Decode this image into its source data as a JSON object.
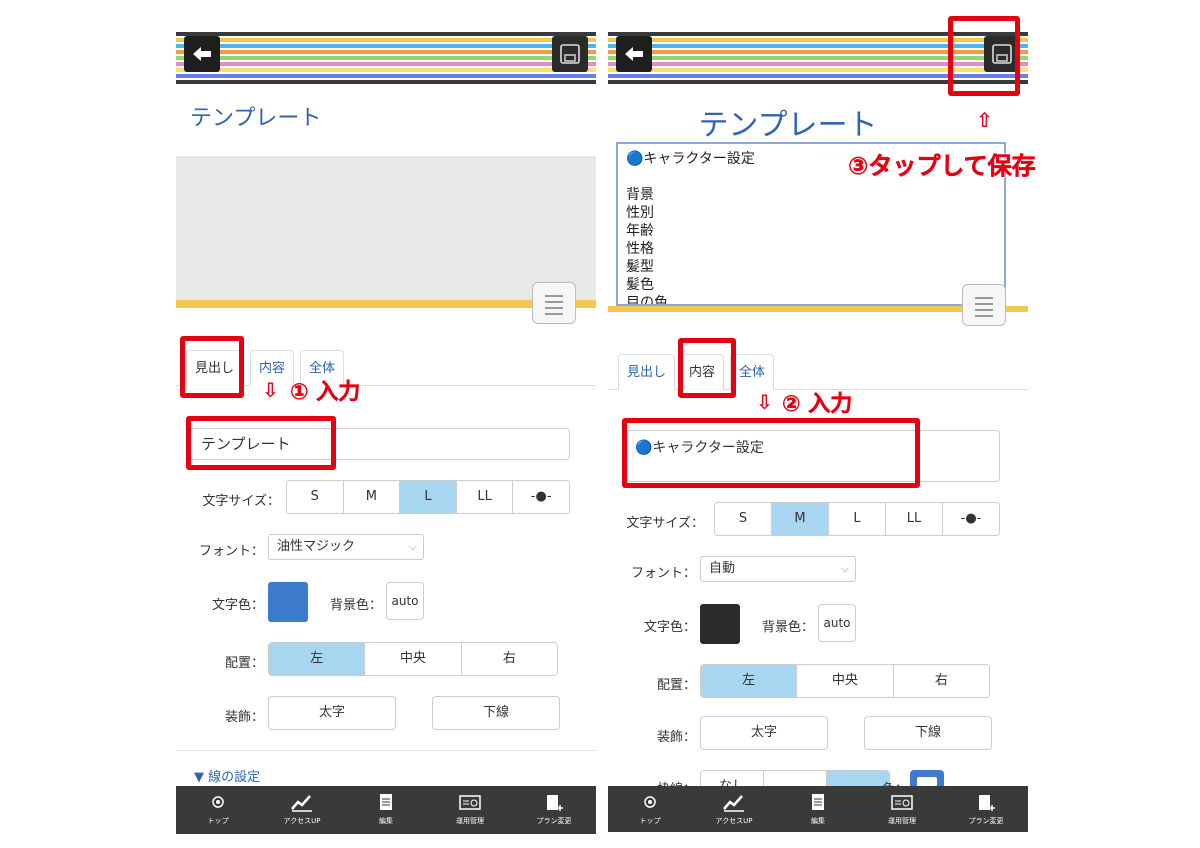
{
  "left": {
    "preview_title": "テンプレート",
    "tabs": [
      "見出し",
      "内容",
      "全体"
    ],
    "heading_value": "テンプレート",
    "text_size_label": "文字サイズ：",
    "text_sizes": [
      "S",
      "M",
      "L",
      "LL",
      "-●-"
    ],
    "text_size_selected": "L",
    "font_label": "フォント：",
    "font_value": "油性マジック",
    "text_color_label": "文字色：",
    "text_color": "#3d7ccc",
    "bg_color_label": "背景色：",
    "bg_color_value": "auto",
    "align_label": "配置：",
    "align_options": [
      "左",
      "中央",
      "右"
    ],
    "align_selected": "左",
    "decoration_label": "装飾：",
    "bold_label": "太字",
    "underline_label": "下線",
    "line_settings": "▼ 線の設定",
    "annotation": "① 入力"
  },
  "right": {
    "preview_title": "テンプレート",
    "content_lines": [
      "🔵キャラクター設定",
      "",
      "背景",
      "性別",
      "年齢",
      "性格",
      "髪型",
      "髪色",
      "目の色"
    ],
    "tabs": [
      "見出し",
      "内容",
      "全体"
    ],
    "content_value": "🔵キャラクター設定",
    "text_size_label": "文字サイズ：",
    "text_sizes": [
      "S",
      "M",
      "L",
      "LL",
      "-●-"
    ],
    "text_size_selected": "M",
    "font_label": "フォント：",
    "font_value": "自動",
    "text_color_label": "文字色：",
    "text_color": "#2b2b2b",
    "bg_color_label": "背景色：",
    "bg_color_value": "auto",
    "align_label": "配置：",
    "align_options": [
      "左",
      "中央",
      "右"
    ],
    "align_selected": "左",
    "decoration_label": "装飾：",
    "bold_label": "太字",
    "underline_label": "下線",
    "border_label": "枠線：",
    "border_none": "なし",
    "border_color_label": "色：",
    "annotation_input": "② 入力",
    "annotation_save": "③タップして保存"
  },
  "bottom_nav": [
    "トップ",
    "アクセスUP",
    "編集",
    "運用管理",
    "プラン変更"
  ],
  "colors": {
    "annotation_red": "#e60012",
    "link_blue": "#2e64b2",
    "selected_blue": "#a8d5f0",
    "nav_bg": "#3a3a3a",
    "stripes": [
      "#3a3a3a",
      "#f2c94c",
      "#4fb7e8",
      "#f2994a",
      "#9bd36b",
      "#e889c9",
      "#f7e26b",
      "#6b7de8",
      "#3a3a3a"
    ]
  },
  "icons": {
    "back": "arrow-left-icon",
    "save": "floppy-disk-icon",
    "grip": "drag-handle-icon"
  }
}
